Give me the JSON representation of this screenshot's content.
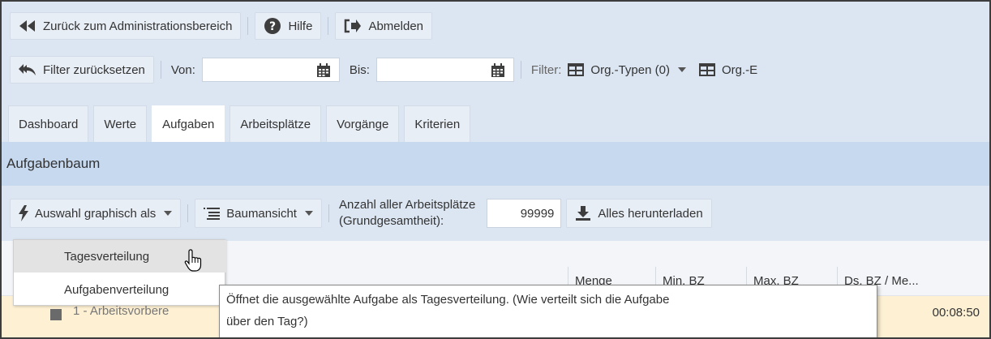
{
  "topbar": {
    "back_label": "Zurück zum Administrationsbereich",
    "help_label": "Hilfe",
    "logout_label": "Abmelden"
  },
  "filterbar": {
    "reset_label": "Filter zurücksetzen",
    "from_label": "Von:",
    "from_value": "",
    "to_label": "Bis:",
    "to_value": "",
    "filter_label": "Filter:",
    "org_types_label": "Org.-Typen (0)",
    "org_e_label": "Org.-E"
  },
  "tabs": [
    {
      "label": "Dashboard"
    },
    {
      "label": "Werte"
    },
    {
      "label": "Aufgaben",
      "active": true
    },
    {
      "label": "Arbeitsplätze"
    },
    {
      "label": "Vorgänge"
    },
    {
      "label": "Kriterien"
    }
  ],
  "section": {
    "title": "Aufgabenbaum"
  },
  "toolbar": {
    "auswahl_label": "Auswahl graphisch als",
    "baumansicht_label": "Baumansicht",
    "anzahl_line1": "Anzahl aller Arbeitsplätze",
    "anzahl_line2": "(Grundgesamtheit):",
    "anzahl_value": "99999",
    "download_label": "Alles herunterladen"
  },
  "table": {
    "columns": [
      "Menge",
      "Min. BZ",
      "Max. BZ",
      "Ds. BZ / Me..."
    ],
    "row": {
      "label": "1 - Arbeitsvorbere",
      "time": "00:08:50"
    }
  },
  "dropdown": {
    "items": [
      "Tagesverteilung",
      "Aufgabenverteilung"
    ]
  },
  "tooltip": {
    "line1": "Öffnet die ausgewählte Aufgabe als Tagesverteilung. (Wie verteilt sich die Aufgabe",
    "line2": "über den Tag?)"
  },
  "colors": {
    "toolbar_bg": "#dce6f2",
    "section_bg": "#c6d9ef",
    "row_bg": "#fdf0d3",
    "icon_dark": "#3e3e3e"
  }
}
